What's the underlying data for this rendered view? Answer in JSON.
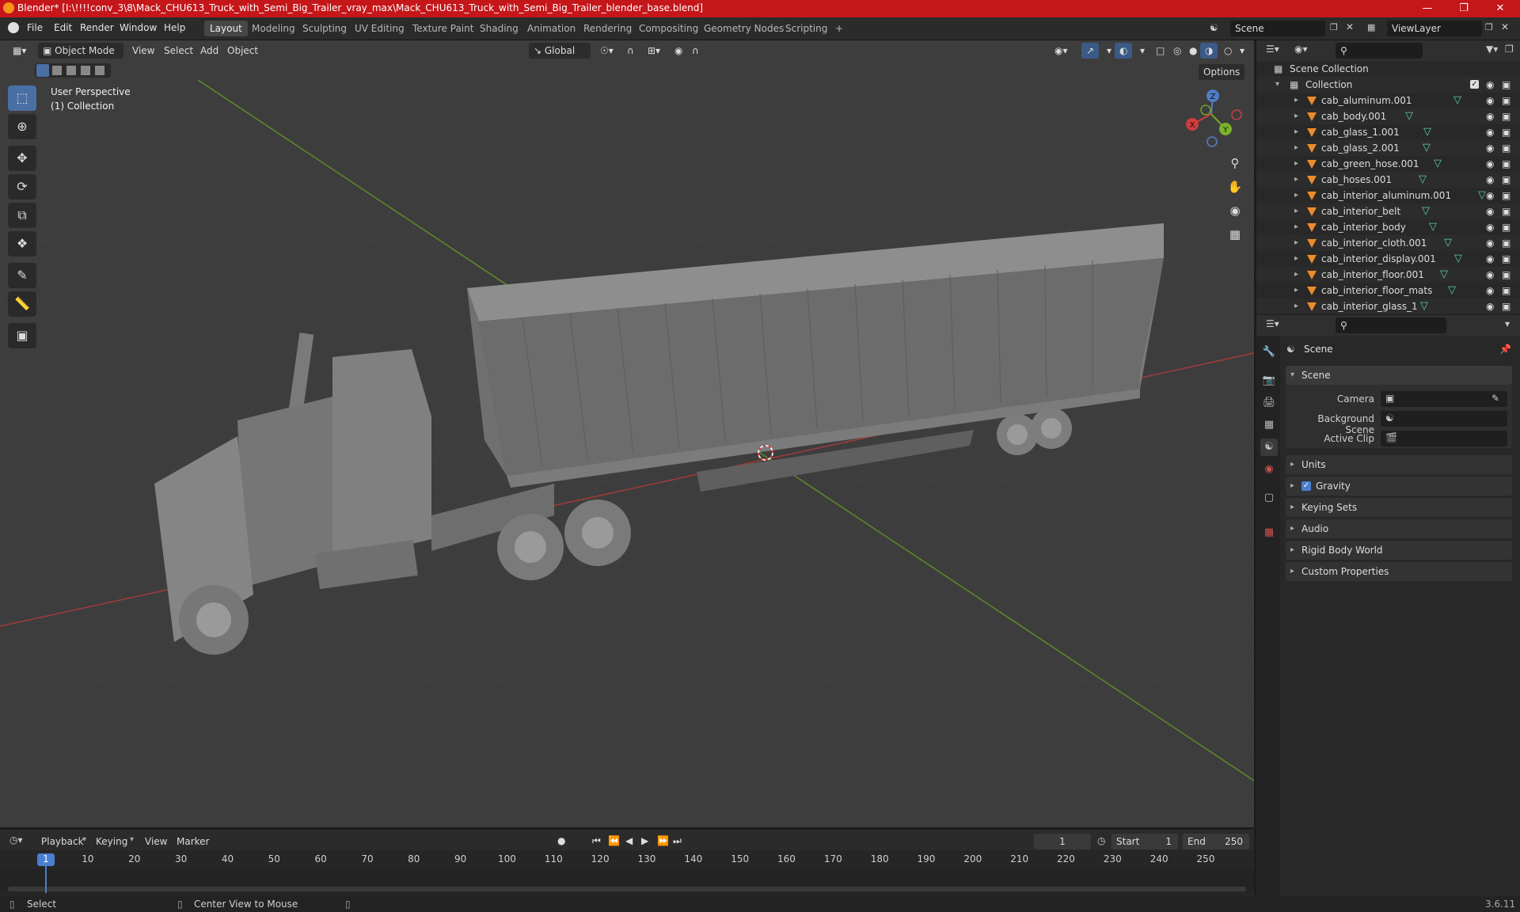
{
  "window": {
    "title": "Blender* [I:\\!!!!conv_3\\8\\Mack_CHU613_Truck_with_Semi_Big_Trailer_vray_max\\Mack_CHU613_Truck_with_Semi_Big_Trailer_blender_base.blend]",
    "minimize": "—",
    "maximize": "❐",
    "close": "✕"
  },
  "menus": [
    "File",
    "Edit",
    "Render",
    "Window",
    "Help"
  ],
  "workspaces": [
    "Layout",
    "Modeling",
    "Sculpting",
    "UV Editing",
    "Texture Paint",
    "Shading",
    "Animation",
    "Rendering",
    "Compositing",
    "Geometry Nodes",
    "Scripting",
    "+"
  ],
  "active_workspace": "Layout",
  "scene_field": "Scene",
  "viewlayer_field": "ViewLayer",
  "viewport_header": {
    "mode": "Object Mode",
    "menus": [
      "View",
      "Select",
      "Add",
      "Object"
    ],
    "orientation": "Global",
    "options": "Options"
  },
  "viewport_overlay": {
    "perspective": "User Perspective",
    "collection": "(1) Collection"
  },
  "gizmo": {
    "z": "Z",
    "y": "Y",
    "x": "X"
  },
  "outliner": {
    "root": "Scene Collection",
    "collection": "Collection",
    "items": [
      "cab_aluminum.001",
      "cab_body.001",
      "cab_glass_1.001",
      "cab_glass_2.001",
      "cab_green_hose.001",
      "cab_hoses.001",
      "cab_interior_aluminum.001",
      "cab_interior_belt",
      "cab_interior_body",
      "cab_interior_cloth.001",
      "cab_interior_display.001",
      "cab_interior_floor.001",
      "cab_interior_floor_mats",
      "cab_interior_glass_1"
    ]
  },
  "properties": {
    "context": "Scene",
    "panel": "Scene",
    "camera_label": "Camera",
    "background_label": "Background Scene",
    "clip_label": "Active Clip",
    "sections": [
      "Units",
      "Gravity",
      "Keying Sets",
      "Audio",
      "Rigid Body World",
      "Custom Properties"
    ],
    "gravity_checked": true
  },
  "timeline": {
    "menus": [
      "Playback",
      "Keying",
      "View",
      "Marker"
    ],
    "current_frame": "1",
    "start_label": "Start",
    "start": "1",
    "end_label": "End",
    "end": "250",
    "ticks": [
      "1",
      "10",
      "20",
      "30",
      "40",
      "50",
      "60",
      "70",
      "80",
      "90",
      "100",
      "110",
      "120",
      "130",
      "140",
      "150",
      "160",
      "170",
      "180",
      "190",
      "200",
      "210",
      "220",
      "230",
      "240",
      "250"
    ]
  },
  "status": {
    "select": "Select",
    "center": "Center View to Mouse",
    "version": "3.6.11"
  }
}
